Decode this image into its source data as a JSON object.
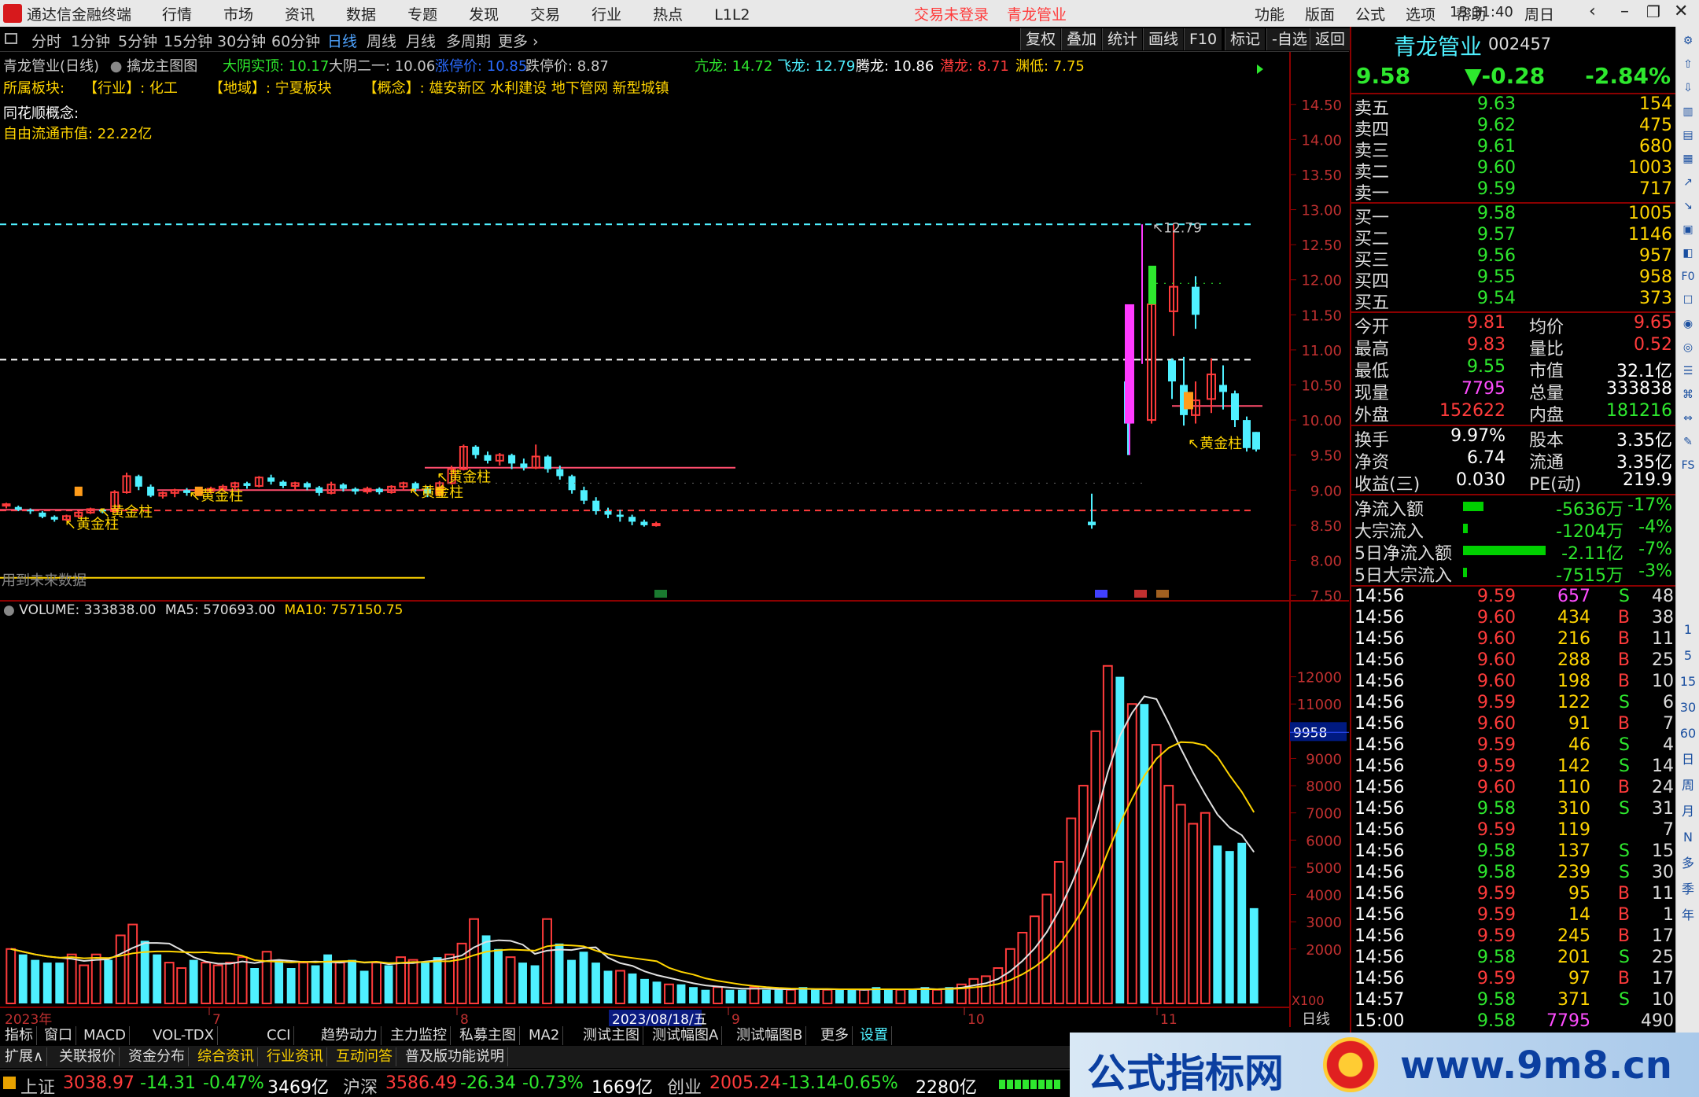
{
  "app": {
    "title": "通达信金融终端",
    "menu": [
      "行情",
      "市场",
      "资讯",
      "数据",
      "专题",
      "发现",
      "交易",
      "行业",
      "热点",
      "L1L2"
    ],
    "login": "交易未登录",
    "stock_name_title": "青龙管业",
    "right_menu": [
      "功能",
      "版面",
      "公式",
      "选项",
      "帮助"
    ],
    "time": "13:31:40",
    "weekday": "周日"
  },
  "periods": [
    "分时",
    "1分钟",
    "5分钟",
    "15分钟",
    "30分钟",
    "60分钟",
    "日线",
    "周线",
    "月线",
    "多周期",
    "更多"
  ],
  "active_period": "日线",
  "tool_buttons": [
    "复权",
    "叠加",
    "统计",
    "画线",
    "F10",
    "标记",
    "-自选",
    "返回"
  ],
  "chart_header": {
    "name": "青龙管业(日线)",
    "formula": "擒龙主图图",
    "items": [
      {
        "t": "大阴实顶: 10.17",
        "c": "#2ee82e"
      },
      {
        "t": "大阴二一: 10.06",
        "c": "#c8c8c8"
      },
      {
        "t": "涨停价: 10.85",
        "c": "#2a6bff"
      },
      {
        "t": "跌停价: 8.87",
        "c": "#c8c8c8"
      },
      {
        "t": "亢龙: 14.72",
        "c": "#2ee82e"
      },
      {
        "t": "飞龙: 12.79",
        "c": "#4ff0ff"
      },
      {
        "t": "腾龙: 10.86",
        "c": "#ffffff"
      },
      {
        "t": "潜龙: 8.71",
        "c": "#ff3b3b"
      },
      {
        "t": "渊低: 7.75",
        "c": "#ffd400"
      }
    ]
  },
  "sector": {
    "label": "所属板块:",
    "industry": "【行业】: 化工",
    "region": "【地域】: 宁夏板块",
    "concept": "【概念】: 雄安新区 水利建设 地下管网 新型城镇"
  },
  "ths_concept": "同花顺概念:",
  "float_cap": "自由流通市值: 22.22亿",
  "future_data": "用到未来数据",
  "price_axis": [
    "14.50",
    "14.00",
    "13.50",
    "13.00",
    "12.50",
    "12.00",
    "11.50",
    "11.00",
    "10.50",
    "10.00",
    "9.50",
    "9.00",
    "8.50",
    "8.00",
    "7.50"
  ],
  "annot_high": "12.79",
  "golden": "黄金柱",
  "volume_header": {
    "vol": "VOLUME: 333838.00",
    "ma5": "MA5: 570693.00",
    "ma10": "MA10: 757150.75"
  },
  "vol_axis": [
    "12000",
    "11000",
    "10000",
    "9000",
    "8000",
    "7000",
    "6000",
    "5000",
    "4000",
    "3000",
    "2000"
  ],
  "vol_cursor": "9958",
  "vol_unit": "X100",
  "date_axis": [
    "2023年",
    "7",
    "8",
    "2023/08/18/五",
    "9",
    "10",
    "11"
  ],
  "date_mode": "日线",
  "bottom_tabs": [
    "指标",
    "窗口",
    "MACD",
    "VOL-TDX",
    "CCI",
    "趋势动力",
    "主力监控",
    "私募主图",
    "MA2",
    "测试主图",
    "测试幅图A",
    "测试幅图B",
    "更多",
    "设置"
  ],
  "bottom_tabs2": [
    "扩展∧",
    "关联报价",
    "资金分布",
    "综合资讯",
    "行业资讯",
    "互动问答",
    "普及版功能说明"
  ],
  "quote": {
    "name": "青龙管业",
    "code": "002457",
    "price": "9.58",
    "change": "▼-0.28",
    "pct": "-2.84%",
    "asks": [
      {
        "l": "卖五",
        "p": "9.63",
        "v": "154"
      },
      {
        "l": "卖四",
        "p": "9.62",
        "v": "475"
      },
      {
        "l": "卖三",
        "p": "9.61",
        "v": "680"
      },
      {
        "l": "卖二",
        "p": "9.60",
        "v": "1003"
      },
      {
        "l": "卖一",
        "p": "9.59",
        "v": "717"
      }
    ],
    "bids": [
      {
        "l": "买一",
        "p": "9.58",
        "v": "1005"
      },
      {
        "l": "买二",
        "p": "9.57",
        "v": "1146"
      },
      {
        "l": "买三",
        "p": "9.56",
        "v": "957"
      },
      {
        "l": "买四",
        "p": "9.55",
        "v": "958"
      },
      {
        "l": "买五",
        "p": "9.54",
        "v": "373"
      }
    ],
    "stats": [
      {
        "a": "今开",
        "b": "9.81",
        "bc": "#ff3b3b",
        "c": "均价",
        "d": "9.65",
        "dc": "#ff3b3b"
      },
      {
        "a": "最高",
        "b": "9.83",
        "bc": "#ff3b3b",
        "c": "量比",
        "d": "0.52",
        "dc": "#ff3b3b"
      },
      {
        "a": "最低",
        "b": "9.55",
        "bc": "#2ee82e",
        "c": "市值",
        "d": "32.1亿",
        "dc": "#fff"
      },
      {
        "a": "现量",
        "b": "7795",
        "bc": "#ff4dff",
        "c": "总量",
        "d": "333838",
        "dc": "#fff"
      },
      {
        "a": "外盘",
        "b": "152622",
        "bc": "#ff3b3b",
        "c": "内盘",
        "d": "181216",
        "dc": "#2ee82e"
      }
    ],
    "stats2": [
      {
        "a": "换手",
        "b": "9.97%",
        "c": "股本",
        "d": "3.35亿"
      },
      {
        "a": "净资",
        "b": "6.74",
        "c": "流通",
        "d": "3.35亿"
      },
      {
        "a": "收益(三)",
        "b": "0.030",
        "c": "PE(动)",
        "d": "219.9"
      }
    ],
    "flows": [
      {
        "a": "净流入额",
        "v": "-5636万",
        "p": "-17%",
        "w": 0.17
      },
      {
        "a": "大宗流入",
        "v": "-1204万",
        "p": "-4%",
        "w": 0.04
      },
      {
        "a": "5日净流入额",
        "v": "-2.11亿",
        "p": "-7%",
        "w": 0.7
      },
      {
        "a": "5日大宗流入",
        "v": "-7515万",
        "p": "-3%",
        "w": 0.03
      }
    ],
    "ticks": [
      [
        "14:56",
        "9.59",
        "657",
        "S",
        "48"
      ],
      [
        "14:56",
        "9.60",
        "434",
        "B",
        "38"
      ],
      [
        "14:56",
        "9.60",
        "216",
        "B",
        "11"
      ],
      [
        "14:56",
        "9.60",
        "288",
        "B",
        "25"
      ],
      [
        "14:56",
        "9.60",
        "198",
        "B",
        "10"
      ],
      [
        "14:56",
        "9.59",
        "122",
        "S",
        "6"
      ],
      [
        "14:56",
        "9.60",
        "91",
        "B",
        "7"
      ],
      [
        "14:56",
        "9.59",
        "46",
        "S",
        "4"
      ],
      [
        "14:56",
        "9.59",
        "142",
        "S",
        "14"
      ],
      [
        "14:56",
        "9.60",
        "110",
        "B",
        "24"
      ],
      [
        "14:56",
        "9.58",
        "310",
        "S",
        "31"
      ],
      [
        "14:56",
        "9.59",
        "119",
        "",
        "7"
      ],
      [
        "14:56",
        "9.58",
        "137",
        "S",
        "15"
      ],
      [
        "14:56",
        "9.58",
        "239",
        "S",
        "30"
      ],
      [
        "14:56",
        "9.59",
        "95",
        "B",
        "11"
      ],
      [
        "14:56",
        "9.59",
        "14",
        "B",
        "1"
      ],
      [
        "14:56",
        "9.59",
        "245",
        "B",
        "17"
      ],
      [
        "14:56",
        "9.58",
        "201",
        "S",
        "25"
      ],
      [
        "14:56",
        "9.59",
        "97",
        "B",
        "17"
      ],
      [
        "14:57",
        "9.58",
        "371",
        "S",
        "10"
      ],
      [
        "15:00",
        "9.58",
        "7795",
        "",
        "490"
      ]
    ]
  },
  "sidebar_items": [
    "1",
    "5",
    "15",
    "30",
    "60",
    "日",
    "周",
    "月",
    "N",
    "多",
    "季",
    "年"
  ],
  "status": {
    "sh": "上证",
    "sh_v": "3038.97",
    "sh_c": "-14.31",
    "sh_p": "-0.47%",
    "sh_a": "3469亿",
    "hs": "沪深",
    "hs_v": "3586.49",
    "hs_c": "-26.34",
    "hs_p": "-0.73%",
    "hs_a": "1669亿",
    "cy": "创业",
    "cy_v": "2005.24",
    "cy_c": "-13.14",
    "cy_p": "-0.65%",
    "cy_a": "2280亿"
  },
  "brand": {
    "name": "公式指标网",
    "url": "www.9m8.cn"
  },
  "chart_data": {
    "type": "candlestick",
    "ylim": [
      7.4,
      14.8
    ],
    "candles": [
      [
        8.78,
        8.8,
        8.74,
        8.82
      ],
      [
        8.76,
        8.72,
        8.7,
        8.78
      ],
      [
        8.72,
        8.7,
        8.66,
        8.74
      ],
      [
        8.68,
        8.62,
        8.6,
        8.7
      ],
      [
        8.62,
        8.58,
        8.55,
        8.64
      ],
      [
        8.58,
        8.63,
        8.56,
        8.65
      ],
      [
        8.63,
        8.68,
        8.6,
        8.7
      ],
      [
        8.68,
        8.73,
        8.66,
        8.75
      ],
      [
        8.72,
        8.7,
        8.67,
        8.74
      ],
      [
        8.7,
        8.97,
        8.68,
        9.0
      ],
      [
        8.97,
        9.2,
        8.95,
        9.25
      ],
      [
        9.2,
        9.05,
        9.0,
        9.22
      ],
      [
        9.05,
        8.92,
        8.9,
        9.08
      ],
      [
        8.92,
        8.96,
        8.88,
        8.98
      ],
      [
        8.96,
        9.0,
        8.9,
        9.02
      ],
      [
        9.0,
        8.96,
        8.92,
        9.03
      ],
      [
        8.96,
        8.99,
        8.93,
        9.01
      ],
      [
        8.99,
        9.02,
        8.95,
        9.05
      ],
      [
        9.02,
        9.05,
        8.98,
        9.08
      ],
      [
        9.05,
        9.1,
        9.0,
        9.12
      ],
      [
        9.1,
        9.06,
        9.02,
        9.12
      ],
      [
        9.06,
        9.18,
        9.04,
        9.2
      ],
      [
        9.18,
        9.12,
        9.08,
        9.22
      ],
      [
        9.12,
        9.06,
        9.03,
        9.14
      ],
      [
        9.06,
        9.1,
        9.0,
        9.12
      ],
      [
        9.1,
        9.04,
        9.0,
        9.12
      ],
      [
        9.04,
        8.96,
        8.92,
        9.06
      ],
      [
        8.96,
        9.08,
        8.94,
        9.12
      ],
      [
        9.08,
        9.02,
        8.98,
        9.1
      ],
      [
        9.02,
        8.98,
        8.94,
        9.04
      ],
      [
        8.98,
        9.02,
        8.95,
        9.05
      ],
      [
        9.02,
        8.97,
        8.94,
        9.04
      ],
      [
        8.97,
        9.05,
        8.95,
        9.07
      ],
      [
        9.05,
        9.1,
        9.0,
        9.12
      ],
      [
        9.1,
        9.02,
        8.98,
        9.12
      ],
      [
        9.02,
        8.95,
        8.9,
        9.05
      ],
      [
        8.95,
        9.1,
        8.92,
        9.13
      ],
      [
        9.1,
        9.3,
        9.08,
        9.35
      ],
      [
        9.3,
        9.62,
        9.28,
        9.65
      ],
      [
        9.62,
        9.5,
        9.45,
        9.64
      ],
      [
        9.5,
        9.42,
        9.38,
        9.55
      ],
      [
        9.42,
        9.5,
        9.35,
        9.53
      ],
      [
        9.5,
        9.38,
        9.3,
        9.52
      ],
      [
        9.38,
        9.32,
        9.28,
        9.45
      ],
      [
        9.32,
        9.48,
        9.3,
        9.65
      ],
      [
        9.48,
        9.3,
        9.25,
        9.5
      ],
      [
        9.3,
        9.2,
        9.15,
        9.35
      ],
      [
        9.2,
        9.0,
        8.95,
        9.22
      ],
      [
        9.0,
        8.85,
        8.8,
        9.05
      ],
      [
        8.85,
        8.7,
        8.65,
        8.9
      ],
      [
        8.7,
        8.65,
        8.6,
        8.75
      ],
      [
        8.65,
        8.62,
        8.55,
        8.72
      ],
      [
        8.62,
        8.55,
        8.5,
        8.65
      ],
      [
        8.55,
        8.5,
        8.48,
        8.58
      ],
      [
        8.5,
        8.52,
        8.48,
        8.55
      ]
    ],
    "candles2": [
      [
        8.55,
        8.5,
        8.45,
        8.95
      ],
      [
        10.55,
        9.95,
        9.5,
        10.6
      ],
      [
        10.0,
        11.65,
        9.95,
        11.65
      ],
      [
        11.55,
        11.9,
        11.2,
        12.79
      ],
      [
        11.9,
        11.5,
        11.3,
        12.05
      ],
      [
        10.85,
        10.55,
        10.3,
        10.88
      ],
      [
        10.5,
        10.07,
        9.92,
        10.9
      ],
      [
        10.07,
        10.28,
        9.95,
        10.55
      ],
      [
        10.3,
        10.65,
        10.1,
        10.88
      ],
      [
        10.5,
        10.4,
        10.15,
        10.78
      ],
      [
        10.38,
        10.0,
        9.9,
        10.42
      ],
      [
        10.0,
        9.6,
        9.55,
        10.05
      ],
      [
        9.83,
        9.58,
        9.55,
        9.83
      ]
    ],
    "volumes": [
      2000,
      1800,
      1600,
      1500,
      1500,
      1800,
      1400,
      1800,
      1600,
      2500,
      2900,
      2300,
      1800,
      1500,
      1300,
      1600,
      1500,
      1400,
      1500,
      1700,
      1300,
      1900,
      1600,
      1300,
      1500,
      1400,
      1800,
      1500,
      1600,
      1200,
      1500,
      1400,
      1700,
      1600,
      1500,
      1700,
      1800,
      2200,
      3100,
      2500,
      2000,
      1700,
      1500,
      1400,
      3100,
      2200,
      1600,
      1900,
      1500,
      1200,
      1200,
      1100,
      900,
      800,
      700,
      700,
      600,
      500,
      600,
      500,
      500,
      600,
      500,
      500,
      500,
      600,
      500,
      500,
      500,
      500,
      500,
      600,
      500,
      500,
      500,
      600,
      500,
      600,
      700,
      900,
      1000,
      1300,
      2000,
      2600,
      3200,
      4000,
      5200,
      6800,
      8000,
      10000,
      12400,
      12000,
      11000,
      11000,
      9500,
      8000,
      7300,
      6600,
      7000,
      5800,
      5600,
      5900,
      3500
    ],
    "vol_up": [
      1,
      0,
      0,
      0,
      0,
      1,
      1,
      1,
      0,
      1,
      1,
      0,
      0,
      1,
      1,
      0,
      1,
      1,
      1,
      1,
      0,
      1,
      0,
      0,
      1,
      0,
      0,
      1,
      0,
      0,
      1,
      0,
      1,
      1,
      0,
      0,
      1,
      1,
      1,
      0,
      0,
      1,
      0,
      0,
      1,
      0,
      0,
      0,
      0,
      0,
      1,
      0,
      0,
      0,
      1,
      0,
      0,
      0,
      1,
      0,
      0,
      1,
      0,
      0,
      1,
      0,
      0,
      1,
      0,
      0,
      1,
      0,
      0,
      1,
      0,
      0,
      1,
      0,
      1,
      1,
      1,
      1,
      1,
      1,
      1,
      1,
      1,
      1,
      1,
      1,
      1,
      0,
      1,
      0,
      1,
      1,
      1,
      1,
      1,
      0,
      0,
      0,
      0
    ]
  }
}
